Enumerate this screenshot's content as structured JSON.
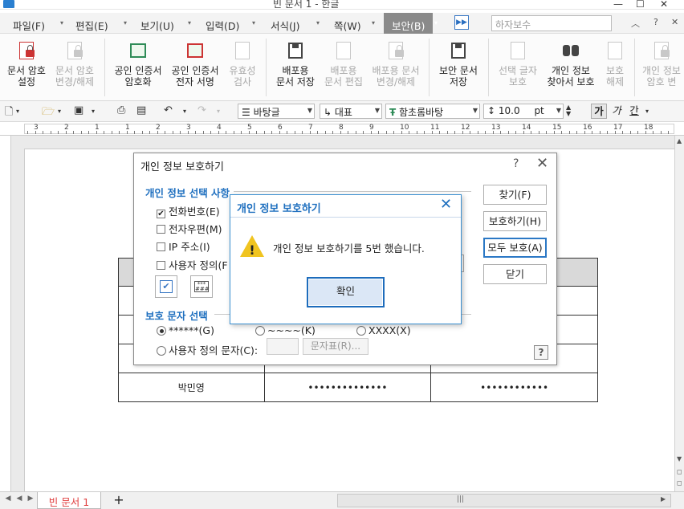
{
  "window": {
    "title": "빈 문서 1 - 한글"
  },
  "menu": {
    "items": [
      "파일(F)",
      "편집(E)",
      "보기(U)",
      "입력(D)",
      "서식(J)",
      "쪽(W)",
      "보안(B)"
    ],
    "font_search_placeholder": "하자보수"
  },
  "ribbon": {
    "doc_password_set": [
      "문서 암호",
      "설정"
    ],
    "doc_password_change": [
      "문서 암호",
      "변경/해제"
    ],
    "cert_encrypt": [
      "공인 인증서",
      "암호화"
    ],
    "cert_sign": [
      "공인 인증서",
      "전자 서명"
    ],
    "validity_check": [
      "유효성",
      "검사"
    ],
    "dist_doc_save": [
      "배포용",
      "문서 저장"
    ],
    "dist_doc_edit": [
      "배포용",
      "문서 편집"
    ],
    "dist_doc_password": [
      "배포용 문서",
      "변경/해제"
    ],
    "secure_doc_save": [
      "보안 문서",
      "저장"
    ],
    "select_char_protect": [
      "선택 글자",
      "보호"
    ],
    "find_protect_personal": [
      "개인 정보",
      "찾아서 보호"
    ],
    "protect_release": [
      "보호",
      "해제"
    ],
    "personal_password": [
      "개인 정보",
      "암호 변"
    ]
  },
  "toolbar": {
    "style": "바탕글",
    "lang": "대표",
    "font": "함초롬바탕",
    "size": "10.0",
    "size_unit": "pt",
    "bold": "가",
    "italic": "가",
    "underline": "간"
  },
  "ruler": {
    "labels": [
      "3",
      "2",
      "1",
      "1",
      "2",
      "3",
      "4",
      "5",
      "6",
      "7",
      "8",
      "9",
      "10",
      "11",
      "12",
      "13",
      "14",
      "15",
      "16",
      "17",
      "18"
    ]
  },
  "table": {
    "rows": [
      [
        "",
        "",
        ""
      ],
      [
        "",
        "",
        ""
      ],
      [
        "",
        "",
        ""
      ],
      [
        "",
        "",
        ""
      ],
      [
        "박민영",
        "••••••••••••••",
        "••••••••••••"
      ]
    ]
  },
  "dialog_main": {
    "title": "개인 정보 보호하기",
    "section_select": "개인 정보 선택 사항",
    "checks": [
      {
        "label": "전화번호(E)",
        "checked": true
      },
      {
        "label": "전자우편(M)",
        "checked": false
      },
      {
        "label": "IP 주소(I)",
        "checked": false
      },
      {
        "label": "사용자 정의(F",
        "checked": false
      }
    ],
    "section_chars": "보호 문자 선택",
    "radios": [
      {
        "label": "******(G)",
        "selected": true
      },
      {
        "label": "~~~~(K)",
        "selected": false
      },
      {
        "label": "XXXX(X)",
        "selected": false
      }
    ],
    "custom_char_label": "사용자 정의 문자(C):",
    "char_map_button": "문자표(R)...",
    "buttons": {
      "find": "찾기(F)",
      "protect": "보호하기(H)",
      "protect_all": "모두 보호(A)",
      "close": "닫기"
    },
    "help": "?"
  },
  "dialog_message": {
    "title": "개인 정보 보호하기",
    "message": "개인 정보 보호하기를 5번 했습니다.",
    "ok": "확인"
  },
  "tabs": {
    "document": "빈 문서 1",
    "add": "+"
  },
  "colors": {
    "accent": "#1e6fbf",
    "active_menu": "#8a8a8a",
    "tab_text": "#e04040"
  }
}
